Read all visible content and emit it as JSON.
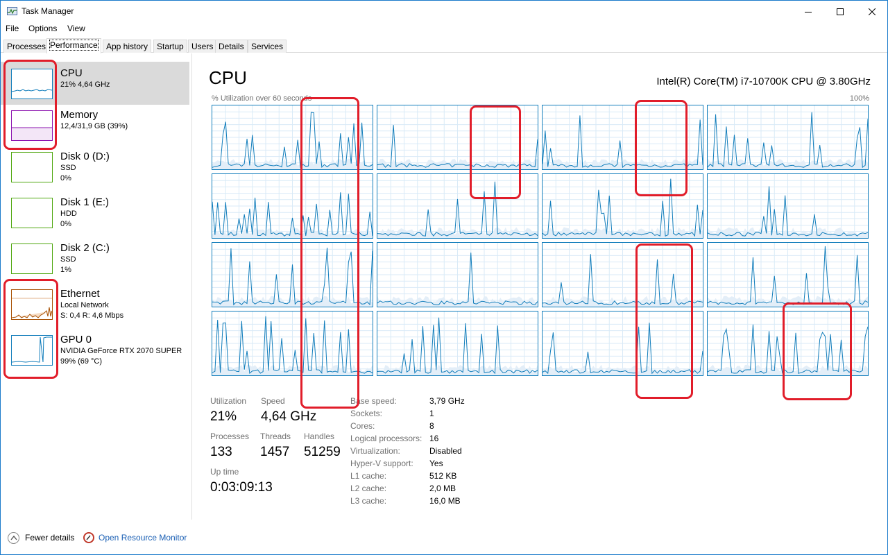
{
  "window": {
    "title": "Task Manager"
  },
  "menu": [
    "File",
    "Options",
    "View"
  ],
  "tabs": [
    "Processes",
    "Performance",
    "App history",
    "Startup",
    "Users",
    "Details",
    "Services"
  ],
  "active_tab": "Performance",
  "sidebar": [
    {
      "name": "CPU",
      "lines": [
        "21% 4,64 GHz"
      ],
      "color": "#117dbb",
      "selected": true
    },
    {
      "name": "Memory",
      "lines": [
        "12,4/31,9 GB (39%)"
      ],
      "color": "#8b12ae"
    },
    {
      "name": "Disk 0 (D:)",
      "lines": [
        "SSD",
        "0%"
      ],
      "color": "#4da60c"
    },
    {
      "name": "Disk 1 (E:)",
      "lines": [
        "HDD",
        "0%"
      ],
      "color": "#4da60c"
    },
    {
      "name": "Disk 2 (C:)",
      "lines": [
        "SSD",
        "1%"
      ],
      "color": "#4da60c"
    },
    {
      "name": "Ethernet",
      "lines": [
        "Local Network",
        "S: 0,4 R: 4,6 Mbps"
      ],
      "color": "#a74f01"
    },
    {
      "name": "GPU 0",
      "lines": [
        "NVIDIA GeForce RTX 2070 SUPER",
        "99% (69 °C)"
      ],
      "color": "#117dbb"
    }
  ],
  "cpu": {
    "title": "CPU",
    "model": "Intel(R) Core(TM) i7-10700K CPU @ 3.80GHz",
    "graph_caption": "% Utilization over 60 seconds",
    "graph_max": "100%",
    "line_color": "#117dbb",
    "stats": {
      "utilization_label": "Utilization",
      "utilization": "21%",
      "speed_label": "Speed",
      "speed": "4,64 GHz",
      "processes_label": "Processes",
      "processes": "133",
      "threads_label": "Threads",
      "threads": "1457",
      "handles_label": "Handles",
      "handles": "51259",
      "uptime_label": "Up time",
      "uptime": "0:03:09:13"
    },
    "specs": [
      {
        "label": "Base speed:",
        "value": "3,79 GHz"
      },
      {
        "label": "Sockets:",
        "value": "1"
      },
      {
        "label": "Cores:",
        "value": "8"
      },
      {
        "label": "Logical processors:",
        "value": "16"
      },
      {
        "label": "Virtualization:",
        "value": "Disabled"
      },
      {
        "label": "Hyper-V support:",
        "value": "Yes"
      },
      {
        "label": "L1 cache:",
        "value": "512 KB"
      },
      {
        "label": "L2 cache:",
        "value": "2,0 MB"
      },
      {
        "label": "L3 cache:",
        "value": "16,0 MB"
      }
    ]
  },
  "footer": {
    "fewer_details": "Fewer details",
    "open_resource_monitor": "Open Resource Monitor"
  },
  "annotation_color": "#e11d2a"
}
